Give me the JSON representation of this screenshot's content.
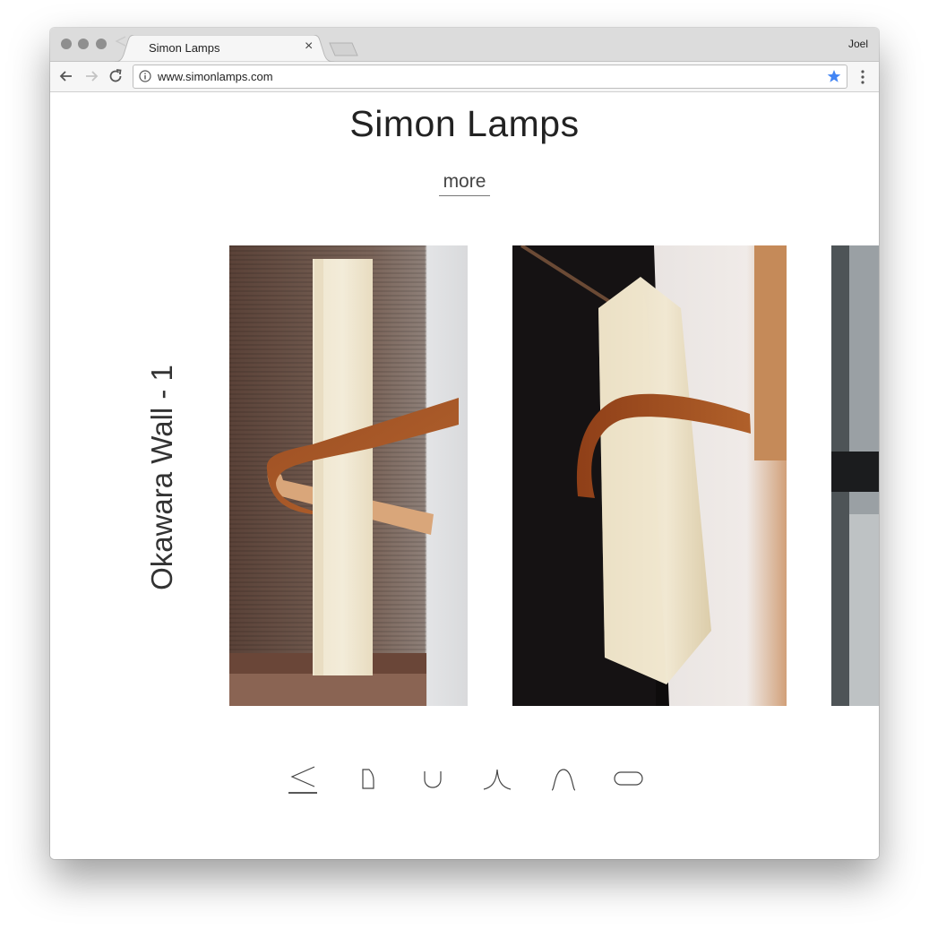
{
  "browser": {
    "tab_title": "Simon Lamps",
    "url": "www.simonlamps.com",
    "profile_name": "Joel",
    "tab_close_glyph": "×",
    "icons": [
      "favicon-icon",
      "back-arrow-icon",
      "forward-arrow-icon",
      "reload-icon",
      "info-icon",
      "bookmark-star-icon",
      "kebab-menu-icon"
    ],
    "accent_color": "#4285f4"
  },
  "page": {
    "title": "Simon Lamps",
    "more_label": "more",
    "gallery_label": "Okawara Wall - 1",
    "photos": [
      {
        "name": "okawara-wall-photo-1"
      },
      {
        "name": "okawara-wall-photo-2"
      },
      {
        "name": "okawara-wall-photo-3-partial"
      }
    ],
    "shape_nav": [
      {
        "name": "wedge-shape-icon",
        "selected": true
      },
      {
        "name": "tall-rounded-shape-icon",
        "selected": false
      },
      {
        "name": "u-shape-icon",
        "selected": false
      },
      {
        "name": "flare-shape-icon",
        "selected": false
      },
      {
        "name": "arch-shape-icon",
        "selected": false
      },
      {
        "name": "pill-shape-icon",
        "selected": false
      }
    ]
  }
}
